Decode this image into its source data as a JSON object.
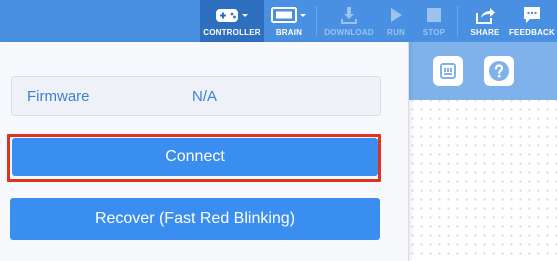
{
  "toolbar": {
    "controller": "CONTROLLER",
    "brain": "BRAIN",
    "download": "DOWNLOAD",
    "run": "RUN",
    "stop": "STOP",
    "share": "SHARE",
    "feedback": "FEEDBACK"
  },
  "panel": {
    "firmware_label": "Firmware",
    "firmware_value": "N/A",
    "connect_label": "Connect",
    "recover_label": "Recover (Fast Red Blinking)"
  },
  "icons": {
    "controller": "gamepad-icon",
    "brain": "brain-device-icon",
    "download": "download-icon",
    "run": "play-icon",
    "stop": "stop-icon",
    "share": "share-icon",
    "feedback": "chat-bubble-icon",
    "workspace_1": "device-port-icon",
    "workspace_2": "help-icon"
  },
  "colors": {
    "toolbar": "#4a90e2",
    "button": "#3a8ef0",
    "highlight": "#e0321e"
  }
}
